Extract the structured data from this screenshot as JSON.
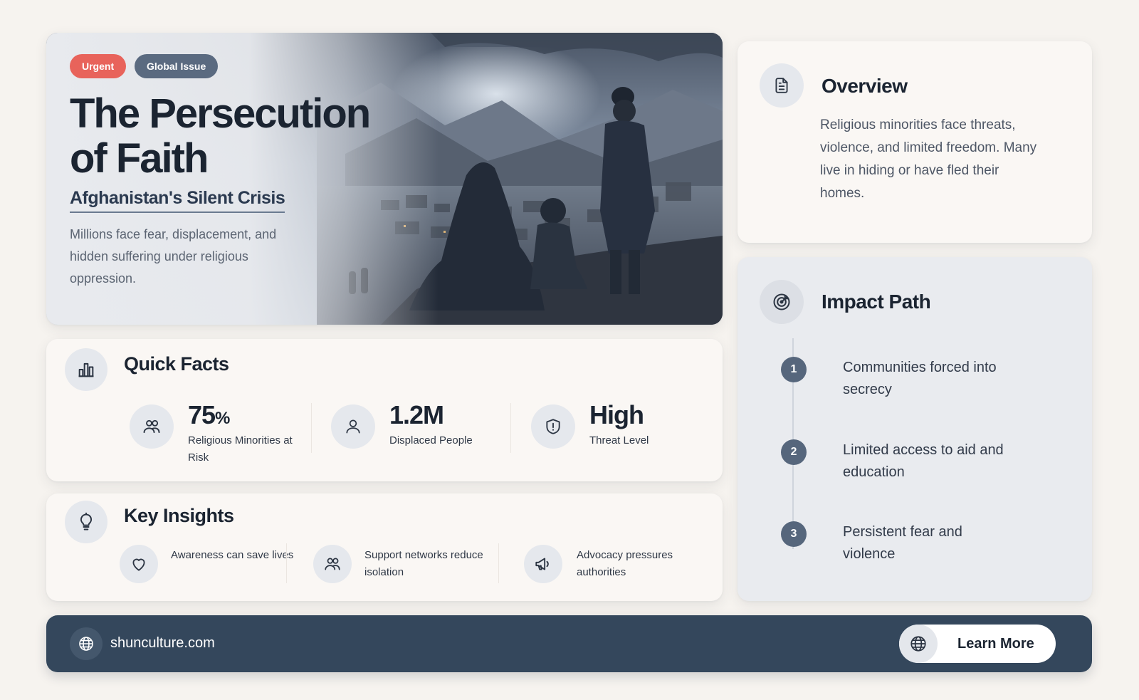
{
  "hero": {
    "badges": [
      "Urgent",
      "Global Issue"
    ],
    "title": "The Persecution of Faith",
    "subtitle": "Afghanistan's Silent Crisis",
    "description": "Millions face fear, displacement, and hidden suffering under religious oppression."
  },
  "overview": {
    "title": "Overview",
    "text": "Religious minorities face threats, violence, and limited freedom. Many live in hiding or have fled their homes."
  },
  "impact_path": {
    "title": "Impact Path",
    "steps": [
      {
        "number": "1",
        "text": "Communities forced into secrecy"
      },
      {
        "number": "2",
        "text": "Limited access to aid and education"
      },
      {
        "number": "3",
        "text": "Persistent fear and violence"
      }
    ]
  },
  "quick_facts": {
    "title": "Quick Facts",
    "facts": [
      {
        "value": "75",
        "unit": "%",
        "label": "Religious Minorities at Risk",
        "icon": "people-group-icon"
      },
      {
        "value": "1.2M",
        "unit": "",
        "label": "Displaced People",
        "icon": "person-icon"
      },
      {
        "value": "High",
        "unit": "",
        "label": "Threat Level",
        "icon": "shield-alert-icon"
      }
    ]
  },
  "key_insights": {
    "title": "Key Insights",
    "items": [
      {
        "text": "Awareness can save lives",
        "icon": "heart-icon"
      },
      {
        "text": "Support networks reduce isolation",
        "icon": "people-group-icon"
      },
      {
        "text": "Advocacy pressures authorities",
        "icon": "megaphone-icon"
      }
    ]
  },
  "footer": {
    "site": "shunculture.com",
    "cta_label": "Learn More"
  },
  "colors": {
    "accent_urgent": "#e8635b",
    "badge_secondary": "#5a6a80",
    "footer_bg": "#34475c",
    "step_circle": "#56667c"
  }
}
